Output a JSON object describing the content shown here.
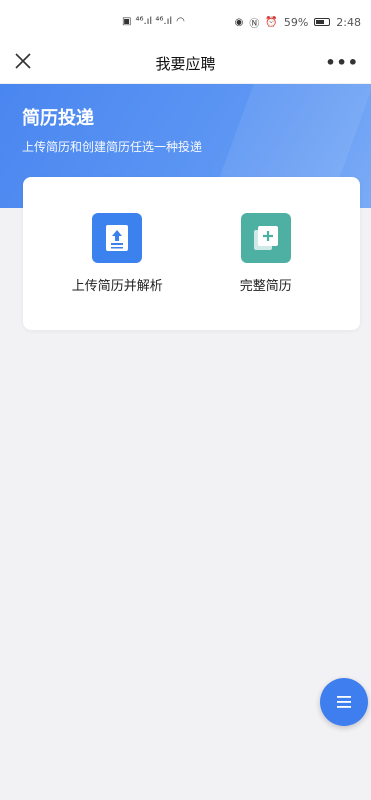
{
  "status_bar": {
    "left_indicators": "⁴⁶.ıl ⁴⁶.ıl",
    "battery_percent": "59%",
    "time": "2:48"
  },
  "nav": {
    "title": "我要应聘",
    "close_icon": "close-icon",
    "more_icon": "more-icon",
    "more_symbol": "•••"
  },
  "hero": {
    "title": "简历投递",
    "subtitle": "上传简历和创建简历任选一种投递",
    "gradient_start": "#4a86f0",
    "gradient_end": "#7aabf6"
  },
  "options": [
    {
      "label": "上传简历并解析",
      "icon": "upload-document-icon",
      "color": "#3b82ee"
    },
    {
      "label": "完整简历",
      "icon": "add-document-icon",
      "color": "#4db0a3"
    }
  ],
  "fab": {
    "icon": "menu-icon",
    "color": "#3f7eef"
  }
}
